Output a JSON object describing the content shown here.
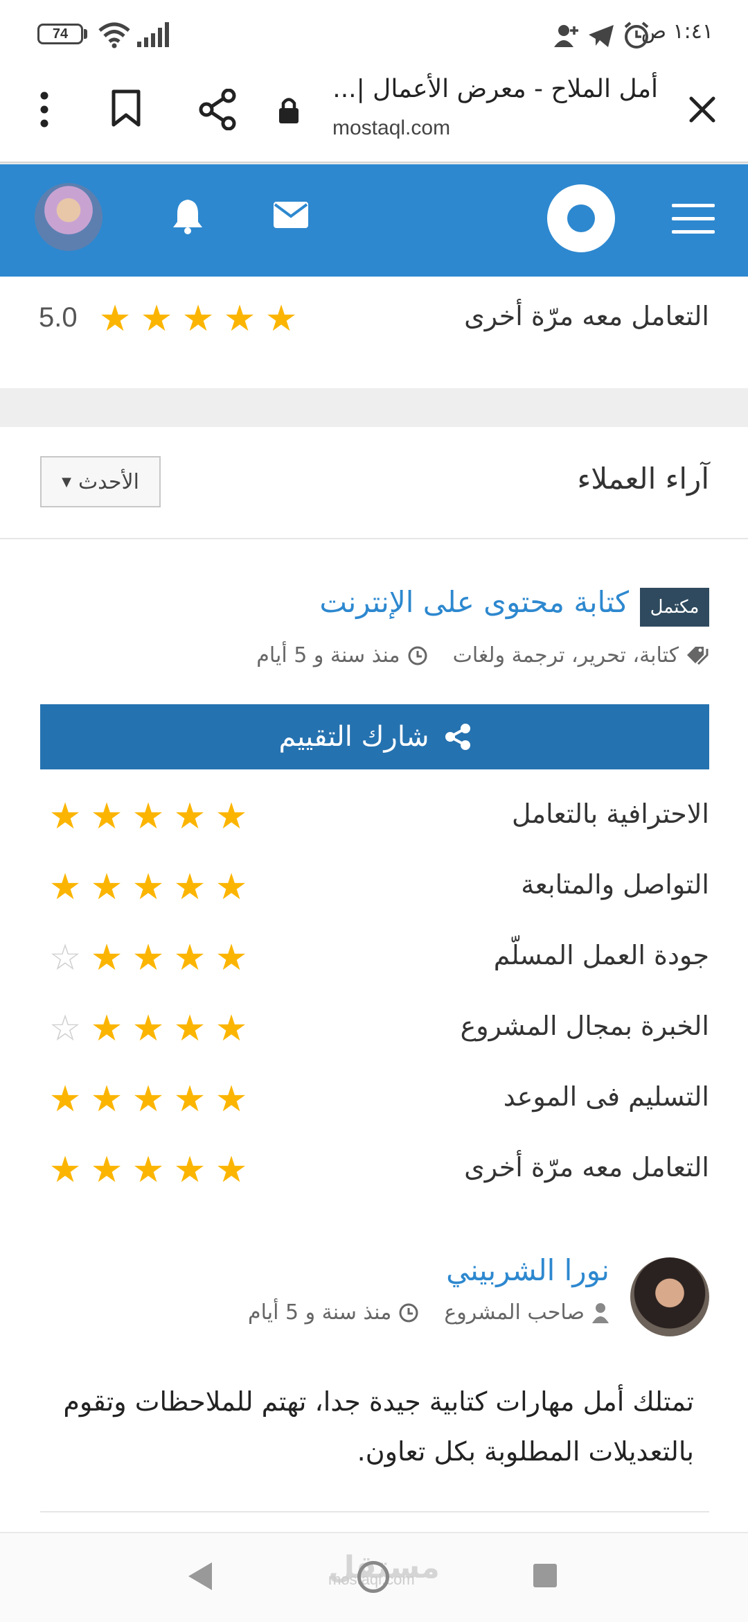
{
  "status_bar": {
    "battery": "74",
    "time": "١:٤١ ص"
  },
  "browser": {
    "page_title": "أمل الملاح - معرض الأعمال |...",
    "domain": "mostaql.com"
  },
  "top_rating": {
    "label": "التعامل معه مرّة أخرى",
    "score": "5.0",
    "stars": 5
  },
  "reviews": {
    "title": "آراء العملاء",
    "sort_label": "الأحدث"
  },
  "project": {
    "badge": "مكتمل",
    "title": "كتابة محتوى على الإنترنت",
    "tags": "كتابة، تحرير، ترجمة ولغات",
    "time": "منذ سنة و 5 أيام",
    "share_label": "شارك التقييم"
  },
  "criteria": [
    {
      "label": "الاحترافية بالتعامل",
      "stars": 5
    },
    {
      "label": "التواصل والمتابعة",
      "stars": 5
    },
    {
      "label": "جودة العمل المسلّم",
      "stars": 4
    },
    {
      "label": "الخبرة بمجال المشروع",
      "stars": 4
    },
    {
      "label": "التسليم فى الموعد",
      "stars": 5
    },
    {
      "label": "التعامل معه مرّة أخرى",
      "stars": 5
    }
  ],
  "reviewer": {
    "name": "نورا الشربيني",
    "role": "صاحب المشروع",
    "time": "منذ سنة و 5 أيام",
    "text": "تمتلك أمل مهارات كتابية جيدة جدا، تهتم للملاحظات وتقوم بالتعديلات المطلوبة بكل تعاون."
  },
  "watermark": {
    "text": "مستقل",
    "sub": "mostaql.com"
  },
  "colors": {
    "brand_blue": "#2d88cf",
    "share_blue": "#2572b0",
    "star": "#fbb500",
    "badge": "#2f4a5e"
  },
  "icons": [
    "close-icon",
    "lock-icon",
    "share-icon",
    "bookmark-icon",
    "more-vert-icon",
    "menu-icon",
    "bell-icon",
    "mail-icon",
    "star-icon",
    "tag-icon",
    "clock-icon",
    "user-icon",
    "wifi-icon",
    "signal-icon",
    "telegram-icon",
    "alarm-icon"
  ]
}
